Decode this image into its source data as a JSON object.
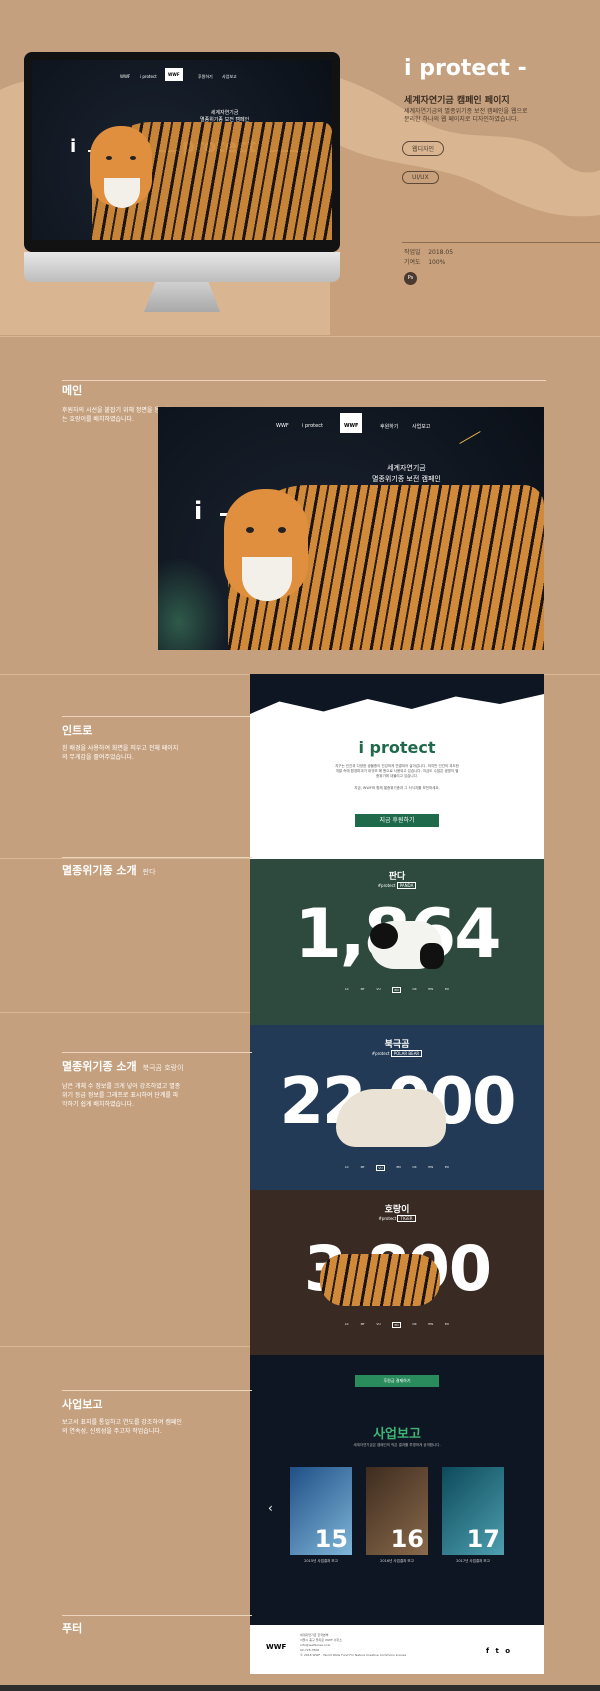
{
  "nav_dots": 4,
  "hero": {
    "title": "i protect -",
    "subtitle": "세계자연기금 캠페인 페이지",
    "description": "세계자연기금의 멸종위기종 보전 캠페인을 웹으로 분리한 하나의 웹 페이지로 디자인하였습니다.",
    "tags": [
      "웹디자인",
      "UI/UX"
    ],
    "meta": [
      {
        "label": "작업일",
        "value": "2018.05"
      },
      {
        "label": "기여도",
        "value": "100%"
      }
    ],
    "tool_badge": "Ps"
  },
  "mockup": {
    "nav": [
      "WWF",
      "i protect",
      "후원하기",
      "사업보고"
    ],
    "logo": "WWF",
    "kicker_line1": "세계자연기금",
    "kicker_line2": "멸종위기종 보전 캠페인",
    "word_left": "i",
    "word_right": "protect"
  },
  "sections": [
    {
      "title": "메인",
      "sub": "",
      "desc": "후원자의 시선을 붙잡기 위해 정면을 응시하는 호랑이를 배치하였습니다."
    },
    {
      "title": "인트로",
      "sub": "",
      "desc": "흰 배경을 사용하여 화면을 띄우고 전체 페이지의 무게감을 줄여주었습니다."
    },
    {
      "title": "멸종위기종 소개",
      "sub": "판다",
      "desc": ""
    },
    {
      "title": "멸종위기종 소개",
      "sub": "북극곰 호랑이",
      "desc": "남은 개체 수 정보를 크게 넣어 강조하였고 멸종위기 등급 정보를 그래프로 표시하여 단계를 파악하기 쉽게 배치하였습니다."
    },
    {
      "title": "사업보고",
      "sub": "",
      "desc": "보고서 표지를 통일하고 연도를 강조하여 캠페인의 연속성, 신뢰성을 주고자 작업습니다."
    },
    {
      "title": "푸터",
      "sub": "",
      "desc": ""
    }
  ],
  "intro": {
    "title": "i protect",
    "body1": "지구는 인간과 다양한 생물종이 건강하게 연결되어 살아갑니다. 하지만 인간의 과도한 개발 속에 환경파괴가 대규모 해 왔으로 사용되고 있습니다. 지금도 수많은 생명이 멸종위기에 내몰리고 있습니다.",
    "body2": "지금, WWF와 함께 멸종위기종과 그 서식지를 보전하세요.",
    "button": "지금 후원하기"
  },
  "animals": [
    {
      "name": "판다",
      "hash": "#protect",
      "tag": "PANDA",
      "count": "1,864",
      "color": "#2e4a3e"
    },
    {
      "name": "북극곰",
      "hash": "#protect",
      "tag": "POLAR BEAR",
      "count": "22,000",
      "color": "#233a57"
    },
    {
      "name": "호랑이",
      "hash": "#protect",
      "tag": "TIGER",
      "count": "3,890",
      "color": "#3a2a24"
    }
  ],
  "grade_labels": [
    "LC",
    "NT",
    "VU",
    "EN",
    "CR",
    "EW",
    "EX"
  ],
  "donate_button": "후원금 결제하기",
  "reports": {
    "title": "사업보고",
    "desc": "세계자연기금은 캠페인의 작은 결과를 투명하게 공개합니다.",
    "items": [
      {
        "year": "15",
        "caption": "2015년 사업결과 보고"
      },
      {
        "year": "16",
        "caption": "2016년 사업결과 보고"
      },
      {
        "year": "17",
        "caption": "2017년 사업결과 보고"
      }
    ]
  },
  "footer": {
    "logo": "WWF",
    "lines": [
      "세계자연기금 한국본부",
      "서울시 중구 을지로 WWF 사무소",
      "info@wwfkorea.or.kr",
      "02-725-3500"
    ],
    "copyright": "© 2018 WWF - World Wide Fund For Nature Creative Commons license",
    "social": [
      "f",
      "t",
      "o"
    ]
  }
}
